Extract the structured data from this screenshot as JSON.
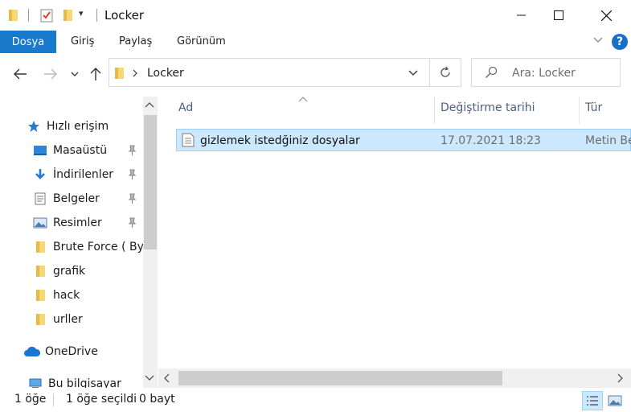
{
  "window": {
    "title": "Locker"
  },
  "ribbon": {
    "tabs": [
      "Dosya",
      "Giriş",
      "Paylaş",
      "Görünüm"
    ],
    "help": "?"
  },
  "address": {
    "current": "Locker"
  },
  "search": {
    "placeholder": "Ara: Locker"
  },
  "nav": {
    "quick_access": "Hızlı erişim",
    "items": [
      "Masaüstü",
      "İndirilenler",
      "Belgeler",
      "Resimler",
      "Brute Force ( By",
      "grafik",
      "hack",
      "urller"
    ],
    "onedrive": "OneDrive",
    "this_pc": "Bu bilgisayar"
  },
  "columns": {
    "name": "Ad",
    "date": "Değiştirme tarihi",
    "type": "Tür"
  },
  "files": [
    {
      "name": "gizlemek istedğiniz dosyalar",
      "date": "17.07.2021 18:23",
      "type": "Metin Be"
    }
  ],
  "status": {
    "count": "1 öğe",
    "selected": "1 öğe seçildi",
    "size": "0 bayt"
  },
  "colors": {
    "accent": "#1979ca",
    "selection": "#cce8ff",
    "folder": "#f8d775"
  }
}
